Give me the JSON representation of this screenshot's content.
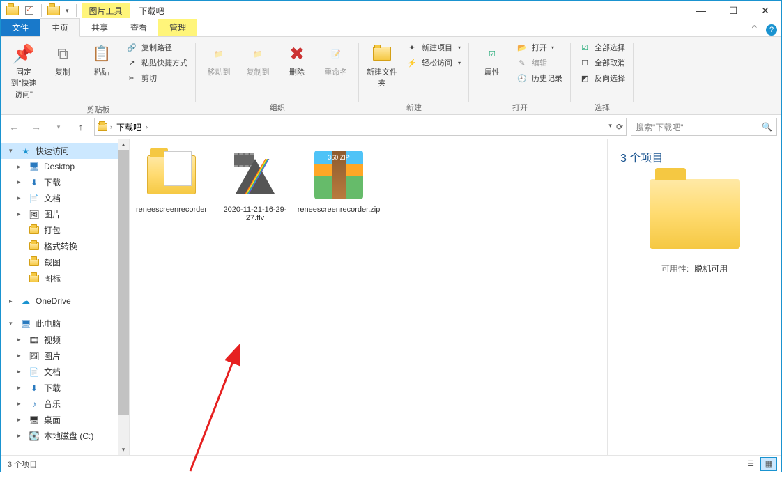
{
  "titlebar": {
    "contextual_tab": "图片工具",
    "title": "下载吧"
  },
  "window_controls": {
    "min": "—",
    "max": "☐",
    "close": "✕"
  },
  "tabs": {
    "file": "文件",
    "home": "主页",
    "share": "共享",
    "view": "查看",
    "manage": "管理"
  },
  "ribbon": {
    "pin": "固定到\"快速访问\"",
    "copy": "复制",
    "paste": "粘贴",
    "copy_path": "复制路径",
    "paste_shortcut": "粘贴快捷方式",
    "cut": "剪切",
    "clipboard_group": "剪贴板",
    "move_to": "移动到",
    "copy_to": "复制到",
    "delete": "删除",
    "rename": "重命名",
    "organize_group": "组织",
    "new_folder": "新建文件夹",
    "new_item": "新建项目",
    "easy_access": "轻松访问",
    "new_group": "新建",
    "properties": "属性",
    "open": "打开",
    "edit": "编辑",
    "history": "历史记录",
    "open_group": "打开",
    "select_all": "全部选择",
    "select_none": "全部取消",
    "invert": "反向选择",
    "select_group": "选择"
  },
  "address": {
    "root": "下载吧",
    "search_placeholder": "搜索\"下载吧\""
  },
  "tree": {
    "quick_access": "快速访问",
    "desktop": "Desktop",
    "downloads": "下载",
    "documents": "文档",
    "pictures": "图片",
    "dabao": "打包",
    "format_convert": "格式转换",
    "screenshot": "截图",
    "icons": "图标",
    "onedrive": "OneDrive",
    "this_pc": "此电脑",
    "videos": "视频",
    "pictures2": "图片",
    "documents2": "文档",
    "downloads2": "下载",
    "music": "音乐",
    "desktop2": "桌面",
    "local_disk": "本地磁盘 (C:)"
  },
  "files": [
    {
      "name": "reneescreenrecorder",
      "type": "folder"
    },
    {
      "name": "2020-11-21-16-29-27.flv",
      "type": "flv"
    },
    {
      "name": "reneescreenrecorder.zip",
      "type": "zip"
    }
  ],
  "details": {
    "title": "3 个项目",
    "meta_label": "可用性:",
    "meta_value": "脱机可用"
  },
  "zip_label": "360\nZIP",
  "status": {
    "text": "3 个项目"
  }
}
